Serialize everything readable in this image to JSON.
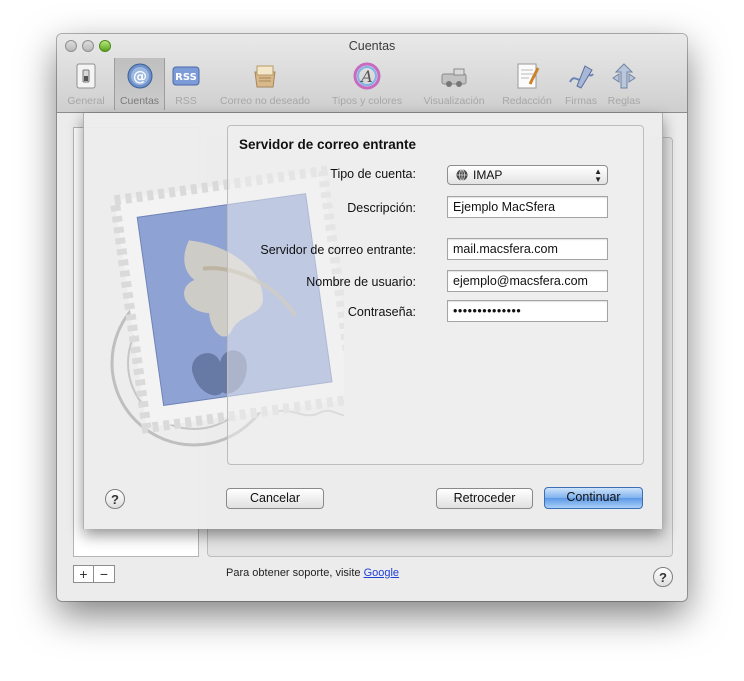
{
  "window": {
    "title": "Cuentas"
  },
  "toolbar": {
    "items": [
      {
        "label": "General",
        "icon": "switch-icon"
      },
      {
        "label": "Cuentas",
        "icon": "at-sign-icon",
        "selected": true
      },
      {
        "label": "RSS",
        "icon": "rss-icon"
      },
      {
        "label": "Correo no deseado",
        "icon": "junk-mail-icon"
      },
      {
        "label": "Tipos y colores",
        "icon": "fonts-colors-icon"
      },
      {
        "label": "Visualización",
        "icon": "viewing-icon"
      },
      {
        "label": "Redacción",
        "icon": "composing-icon"
      },
      {
        "label": "Firmas",
        "icon": "signature-icon"
      },
      {
        "label": "Reglas",
        "icon": "rules-icon"
      }
    ]
  },
  "sheet": {
    "title": "Servidor de correo entrante",
    "account_type_label": "Tipo de cuenta:",
    "account_type_value": "IMAP",
    "description_label": "Descripción:",
    "description_value": "Ejemplo MacSfera",
    "server_label": "Servidor de correo entrante:",
    "server_value": "mail.macsfera.com",
    "username_label": "Nombre de usuario:",
    "username_value": "ejemplo@macsfera.com",
    "password_label": "Contraseña:",
    "password_value": "••••••••••••••",
    "help_label": "?",
    "cancel_label": "Cancelar",
    "back_label": "Retroceder",
    "continue_label": "Continuar"
  },
  "footer": {
    "add_label": "+",
    "remove_label": "−",
    "support_text": "Para obtener soporte, visite ",
    "support_link": "Google",
    "help_label": "?"
  },
  "colors": {
    "accent": "#5d98e6",
    "link": "#1e3fd8",
    "close_light": "#c8c8c8",
    "zoom_light": "#6fb62b"
  }
}
